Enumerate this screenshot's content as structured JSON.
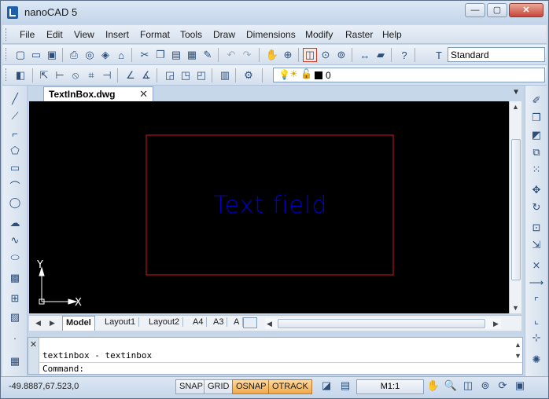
{
  "window": {
    "title": "nanoCAD 5",
    "minimize": "—",
    "maximize": "▢",
    "close": "✕"
  },
  "menu": [
    "File",
    "Edit",
    "View",
    "Insert",
    "Format",
    "Tools",
    "Draw",
    "Dimensions",
    "Modify",
    "Raster",
    "Help"
  ],
  "toolbar": {
    "text_style": "Standard",
    "layer_value": "0"
  },
  "document": {
    "tab_name": "TextInBox.dwg",
    "tab_close": "✕",
    "dropdown": "▼"
  },
  "drawing": {
    "text": "Text field",
    "text_color": "#0000c8",
    "box_color": "#d0141e",
    "ucs_x": "X",
    "ucs_y": "Y"
  },
  "layout_tabs": [
    "Model",
    "Layout1",
    "Layout2",
    "A4",
    "A3",
    "A"
  ],
  "layout_nav": {
    "prev": "◀",
    "next": "▶"
  },
  "command": {
    "history": "textinbox - textinbox",
    "prompt": "Command:"
  },
  "status": {
    "coords": "-49.8887,67.523,0",
    "toggles": [
      {
        "label": "SNAP",
        "on": false
      },
      {
        "label": "GRID",
        "on": false
      },
      {
        "label": "OSNAP",
        "on": true
      },
      {
        "label": "OTRACK",
        "on": true
      }
    ],
    "scale": "M1:1"
  }
}
